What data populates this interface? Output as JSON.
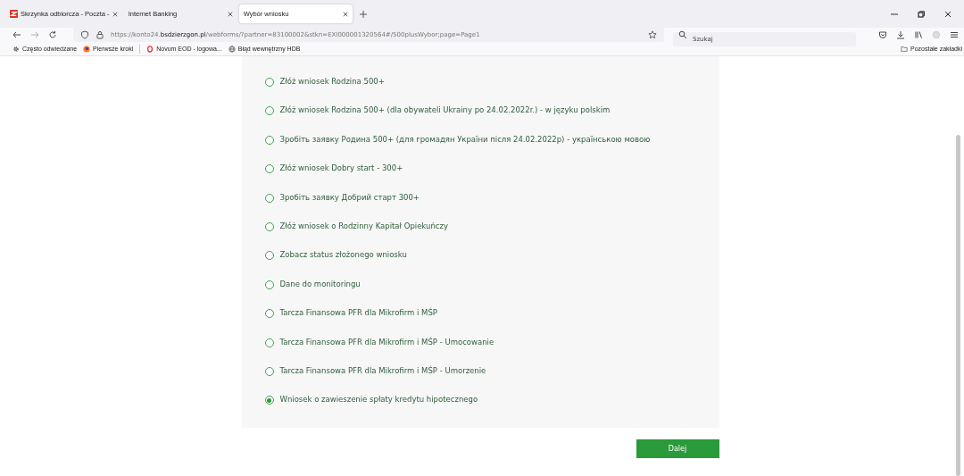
{
  "browser": {
    "tabs": [
      {
        "title": "Skrzynka odbiorcza - Poczta -",
        "selected": false
      },
      {
        "title": "Internet Banking",
        "selected": false
      },
      {
        "title": "Wybór wniosku",
        "selected": true
      }
    ],
    "url": "https://konto24.**bsdzierzgon.pl**/webforms/?partner=83100002&stkn=EXI000001320564#/500plusWybor;page=Page1",
    "search": {
      "placeholder": "Szukaj"
    },
    "bookmarks": [
      {
        "label": "Często odwiedzane"
      },
      {
        "label": "Pierwsze kroki"
      },
      {
        "label": "Novum EOD - logowa..."
      },
      {
        "label": "Błąd wewnętrzny HDB"
      }
    ],
    "other_bookmarks": "Pozostałe zakładki"
  },
  "options": [
    {
      "label": "Złóż wniosek Rodzina 500+",
      "selected": false
    },
    {
      "label": "Złóż wniosek Rodzina 500+ (dla obywateli Ukrainy po 24.02.2022r.) - w języku polskim",
      "selected": false
    },
    {
      "label": "Зробіть заявку Родина 500+ (для громадян України після 24.02.2022р) - українською мовою",
      "selected": false
    },
    {
      "label": "Złóż wniosek Dobry start - 300+",
      "selected": false
    },
    {
      "label": "Зробіть заявку Добрий старт 300+",
      "selected": false
    },
    {
      "label": "Złóż wniosek o Rodzinny Kapitał Opiekuńczy",
      "selected": false
    },
    {
      "label": "Zobacz status złożonego wniosku",
      "selected": false
    },
    {
      "label": "Dane do monitoringu",
      "selected": false
    },
    {
      "label": "Tarcza Finansowa PFR dla Mikrofirm i MŚP",
      "selected": false
    },
    {
      "label": "Tarcza Finansowa PFR dla Mikrofirm i MŚP - Umocowanie",
      "selected": false
    },
    {
      "label": "Tarcza Finansowa PFR dla Mikrofirm i MŚP - Umorzenie",
      "selected": false
    },
    {
      "label": "Wniosek o zawieszenie spłaty kredytu hipotecznego",
      "selected": true
    }
  ],
  "next_button": "Dalej"
}
